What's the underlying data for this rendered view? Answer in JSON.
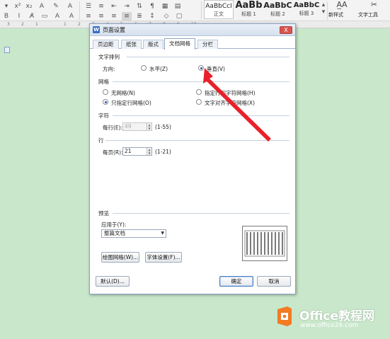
{
  "ribbon": {
    "styles": [
      {
        "sample": "AaBbCcI",
        "name": "正文"
      },
      {
        "sample": "AaBb",
        "name": "标题 1"
      },
      {
        "sample": "AaBbC",
        "name": "标题 2"
      },
      {
        "sample": "AaBbC",
        "name": "标题 3"
      }
    ],
    "new_style": "新样式",
    "text_tool": "文字工具"
  },
  "ruler": {
    "numbers": [
      "3",
      "2",
      "1",
      "1",
      "2",
      "3",
      "4",
      "5",
      "6",
      "7",
      "8",
      "9",
      "10"
    ]
  },
  "dialog": {
    "title": "页面设置",
    "icon_letter": "W",
    "close": "X",
    "tabs": [
      "页边距",
      "纸张",
      "版式",
      "文档网格",
      "分栏"
    ],
    "active_tab": 3,
    "text_direction": {
      "group": "文字排列",
      "label": "方向:",
      "horizontal": "水平(Z)",
      "vertical": "垂直(V)",
      "selected": "vertical"
    },
    "grid": {
      "group": "网格",
      "options": [
        "无网格(N)",
        "指定行和字符网格(H)",
        "只指定行网格(O)",
        "文字对齐字符网格(X)"
      ],
      "selected": "只指定行网格(O)"
    },
    "chars": {
      "group": "字符",
      "per_line_label": "每行(E):",
      "per_line_value": "49",
      "per_line_range": "(1-55)"
    },
    "lines": {
      "group": "行",
      "per_page_label": "每页(R):",
      "per_page_value": "21",
      "per_page_range": "(1-21)"
    },
    "preview": {
      "group": "预览",
      "apply_label": "应用于(Y):",
      "apply_value": "整篇文档"
    },
    "buttons": {
      "draw_grid": "绘图网格(W)...",
      "font_settings": "字体设置(F)...",
      "default": "默认(D)...",
      "ok": "确定",
      "cancel": "取消"
    }
  },
  "watermark": {
    "brand": "Office教程网",
    "url": "www.office26.com"
  },
  "colors": {
    "background": "#c9e7cb",
    "annotation_arrow": "#e8212b",
    "logo_orange": "#f27b23"
  }
}
